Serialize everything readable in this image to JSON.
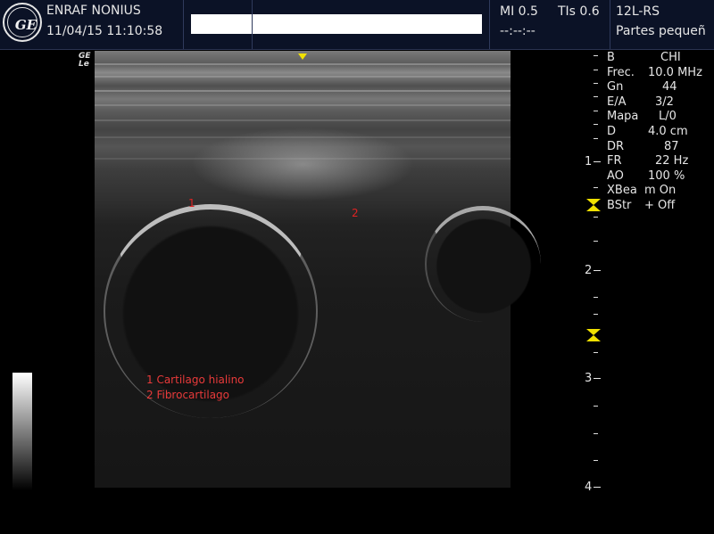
{
  "header": {
    "brand": "ENRAF NONIUS",
    "logo_text": "GE",
    "datetime": "11/04/15 11:10:58",
    "mi": "MI 0.5",
    "tis": "TIs 0.6",
    "time_placeholder": "--:--:--",
    "probe": "12L-RS",
    "preset": "Partes pequeñ"
  },
  "image": {
    "corner_mark_1": "GE",
    "corner_mark_2": "Le",
    "label_1": "1",
    "label_2": "2",
    "legend": [
      "1 Cartilago hialino",
      "2 Fibrocartilago"
    ]
  },
  "scale": {
    "major_labels": [
      "1",
      "2",
      "3",
      "4"
    ]
  },
  "params": [
    {
      "label": "B",
      "value": "CHI"
    },
    {
      "label": "Frec.",
      "value": "10.0 MHz"
    },
    {
      "label": "Gn",
      "value": "44"
    },
    {
      "label": "E/A",
      "value": "3/2"
    },
    {
      "label": "Mapa",
      "value": "L/0"
    },
    {
      "label": "D",
      "value": "4.0 cm"
    },
    {
      "label": "DR",
      "value": "87"
    },
    {
      "label": "FR",
      "value": "22 Hz"
    },
    {
      "label": "AO",
      "value": "100 %"
    },
    {
      "label": "XBea",
      "value": "m On"
    },
    {
      "label": "BStr",
      "value": "+ Off"
    }
  ],
  "colors": {
    "header_bg": "#0b1226",
    "annotation_red": "#e02323",
    "marker_yellow": "#f0e000"
  }
}
